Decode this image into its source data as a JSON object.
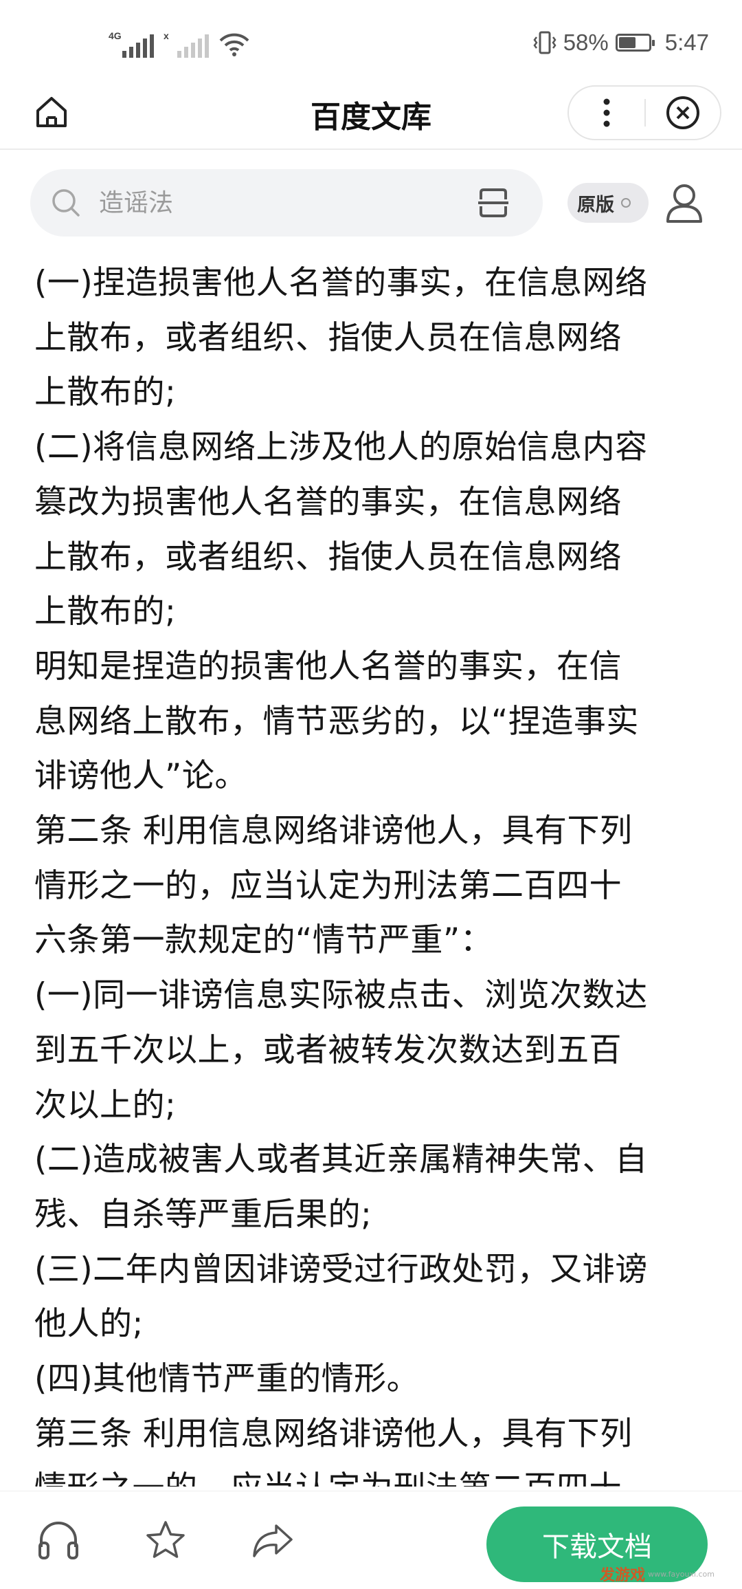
{
  "status_bar": {
    "network_1": "4G",
    "network_2": "x",
    "battery_percent": "58%",
    "battery_level": 0.58,
    "time": "5:47"
  },
  "title_bar": {
    "title": "百度文库"
  },
  "search": {
    "placeholder": "造谣法",
    "original_toggle_label": "原版"
  },
  "document": {
    "lines": [
      "(一)捏造损害他人名誉的事实，在信息网络",
      "上散布，或者组织、指使人员在信息网络",
      "上散布的;",
      "(二)将信息网络上涉及他人的原始信息内容",
      "篡改为损害他人名誉的事实，在信息网络",
      "上散布，或者组织、指使人员在信息网络",
      "上散布的;",
      "明知是捏造的损害他人名誉的事实，在信",
      "息网络上散布，情节恶劣的，以“捏造事实",
      "诽谤他人”论。",
      "第二条 利用信息网络诽谤他人，具有下列",
      "情形之一的，应当认定为刑法第二百四十",
      "六条第一款规定的“情节严重”：",
      "(一)同一诽谤信息实际被点击、浏览次数达",
      "到五千次以上，或者被转发次数达到五百",
      "次以上的;",
      "(二)造成被害人或者其近亲属精神失常、自",
      "残、自杀等严重后果的;",
      "(三)二年内曾因诽谤受过行政处罚，又诽谤",
      "他人的;",
      "(四)其他情节严重的情形。",
      "第三条 利用信息网络诽谤他人，具有下列",
      "情形之一的，应当认定为刑法第二百四十"
    ]
  },
  "bottom_bar": {
    "download_label": "下载文档",
    "watermark_text": "发游戏",
    "watermark_url": "www.fayouxi.com"
  },
  "colors": {
    "accent_green": "#2fb87a",
    "text": "#161616",
    "search_bg": "#f2f3f5"
  }
}
